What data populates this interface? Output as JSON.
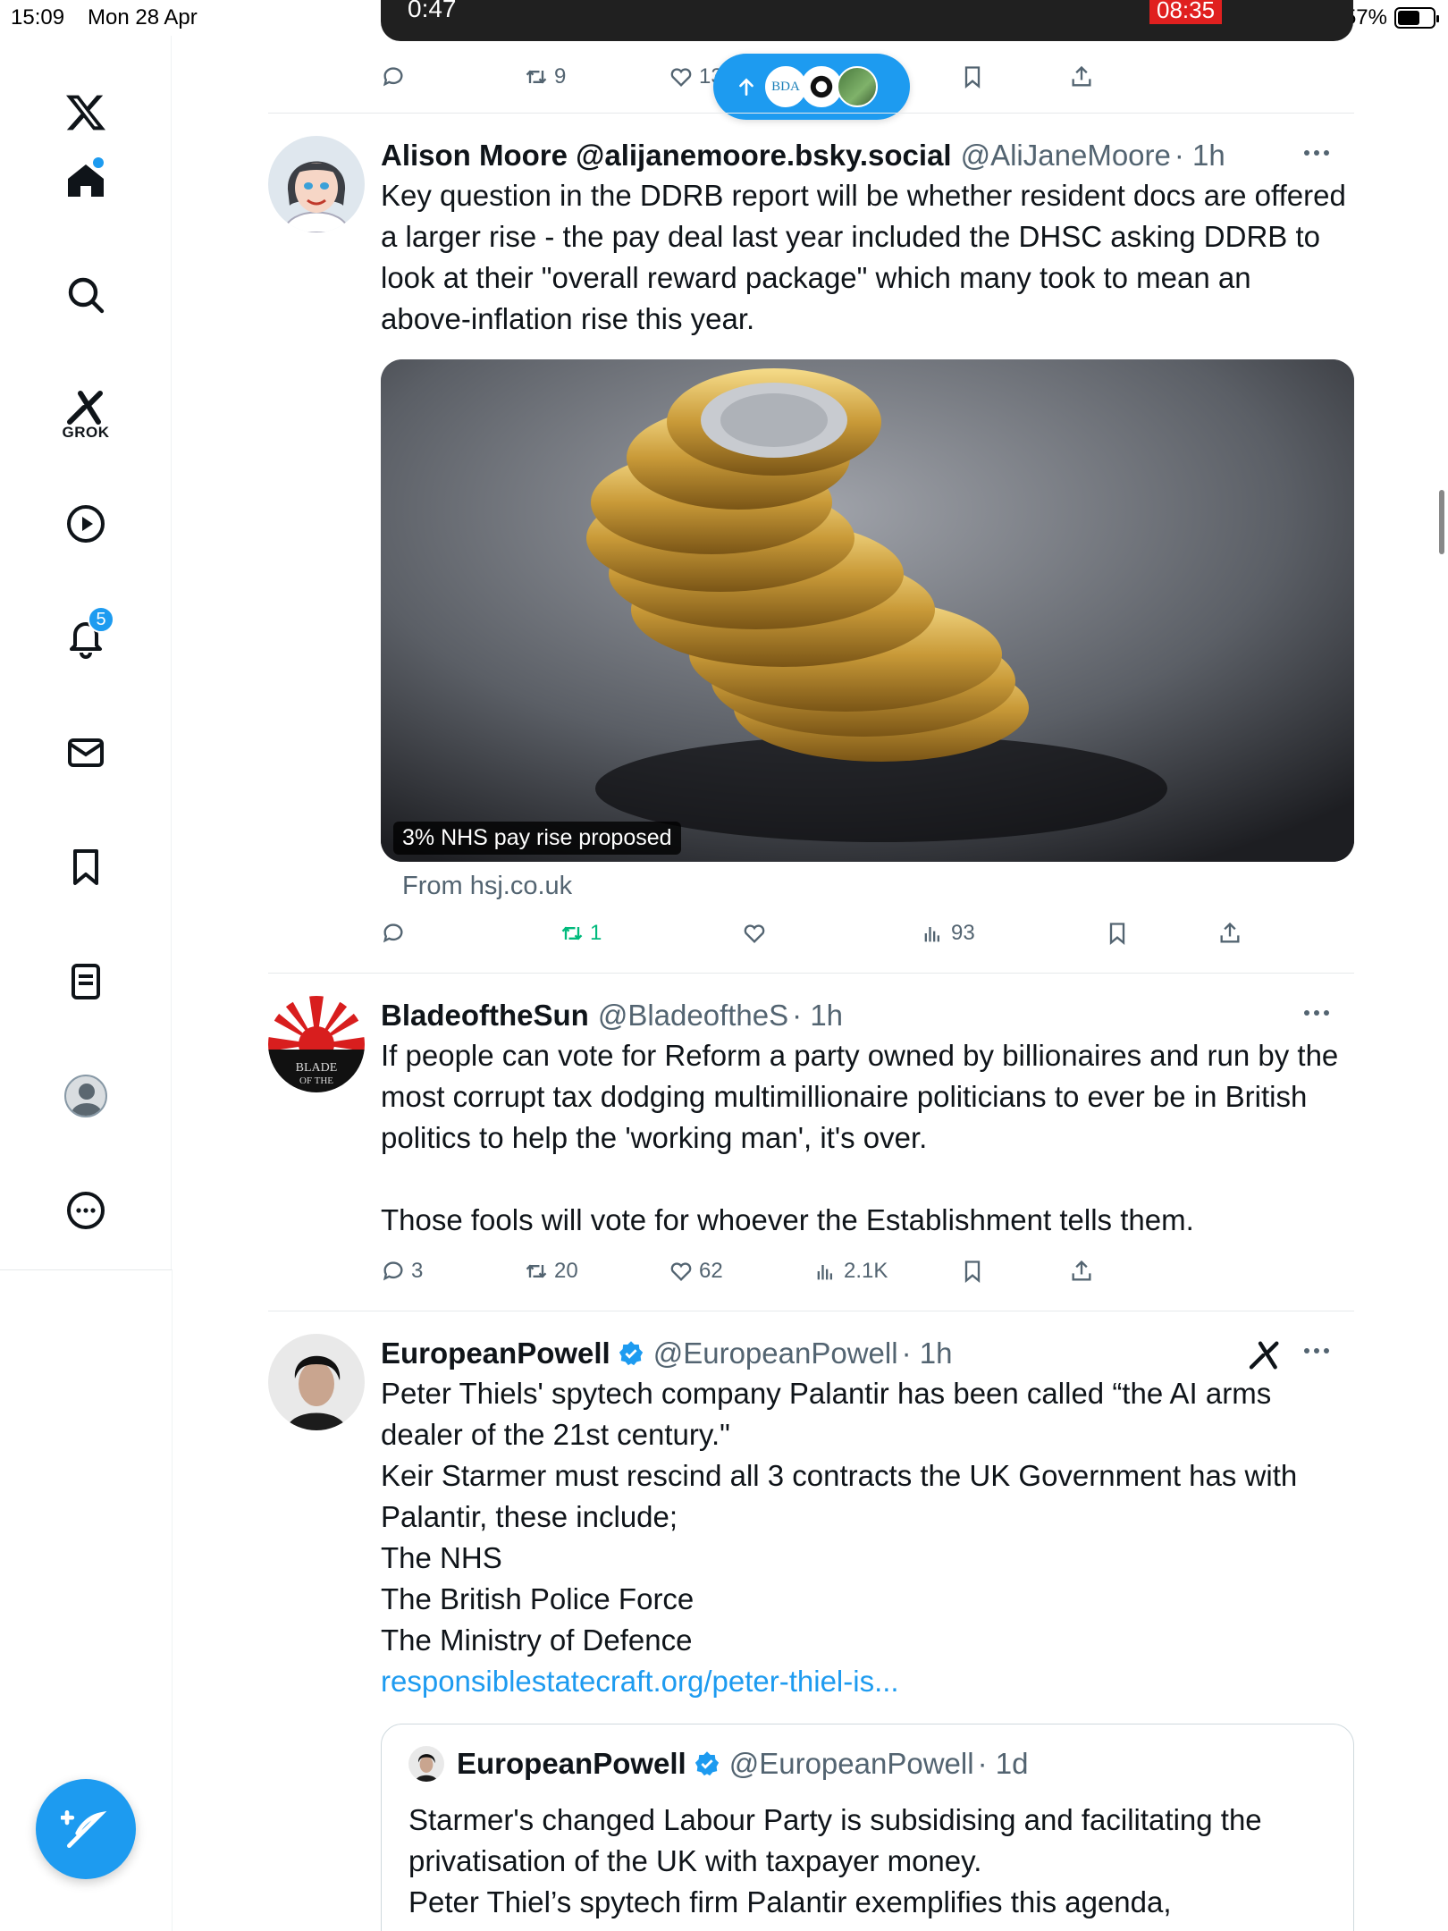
{
  "status_bar": {
    "time": "15:09",
    "date": "Mon 28 Apr",
    "battery": "57%"
  },
  "sidebar": {
    "notifications_badge": "5",
    "grok_label": "GROK"
  },
  "top_partial": {
    "video_time": "0:47",
    "video_tag": "08:35",
    "retweets": "9",
    "likes": "13"
  },
  "new_posts_pill": {
    "bda_label": "BDA"
  },
  "tweets": [
    {
      "name": "Alison Moore @alijanemoore.bsky.social",
      "handle": "@AliJaneMoore",
      "time": "· 1h",
      "text": "Key question in the DDRB report will be whether resident docs are offered a larger rise - the pay deal last year included the DHSC asking DDRB to look at their \"overall reward package\" which many took to mean an above-inflation rise this year.",
      "card_caption": "3% NHS pay rise proposed",
      "card_source": "From hsj.co.uk",
      "replies": "",
      "retweets": "1",
      "likes": "",
      "views": "93"
    },
    {
      "name": "BladeoftheSun",
      "handle": "@BladeoftheS",
      "time": "· 1h",
      "text": "If people can vote for Reform a party owned by billionaires and run by the most corrupt tax dodging multimillionaire politicians to ever be in British politics to help the 'working man', it's over.\n\nThose fools will vote for whoever the Establishment tells them.",
      "replies": "3",
      "retweets": "20",
      "likes": "62",
      "views": "2.1K"
    },
    {
      "name": "EuropeanPowell",
      "handle": "@EuropeanPowell",
      "time": "· 1h",
      "text": "Peter Thiels' spytech company Palantir has been called “the AI arms dealer of the 21st century.\"\nKeir Starmer must rescind all 3 contracts the UK Government has with Palantir, these include;\nThe NHS\nThe British Police Force\nThe Ministry of Defence",
      "link": "responsiblestatecraft.org/peter-thiel-is...",
      "quote": {
        "name": "EuropeanPowell",
        "handle": "@EuropeanPowell",
        "time": "· 1d",
        "text": "Starmer's changed Labour Party is subsidising and facilitating the privatisation of the UK with taxpayer money.\nPeter Thiel’s spytech firm Palantir exemplifies this agenda,"
      }
    }
  ],
  "colors": {
    "accent": "#1d9bf0",
    "text": "#0f1419",
    "muted": "#536471",
    "retweet_active": "#00ba7c"
  }
}
